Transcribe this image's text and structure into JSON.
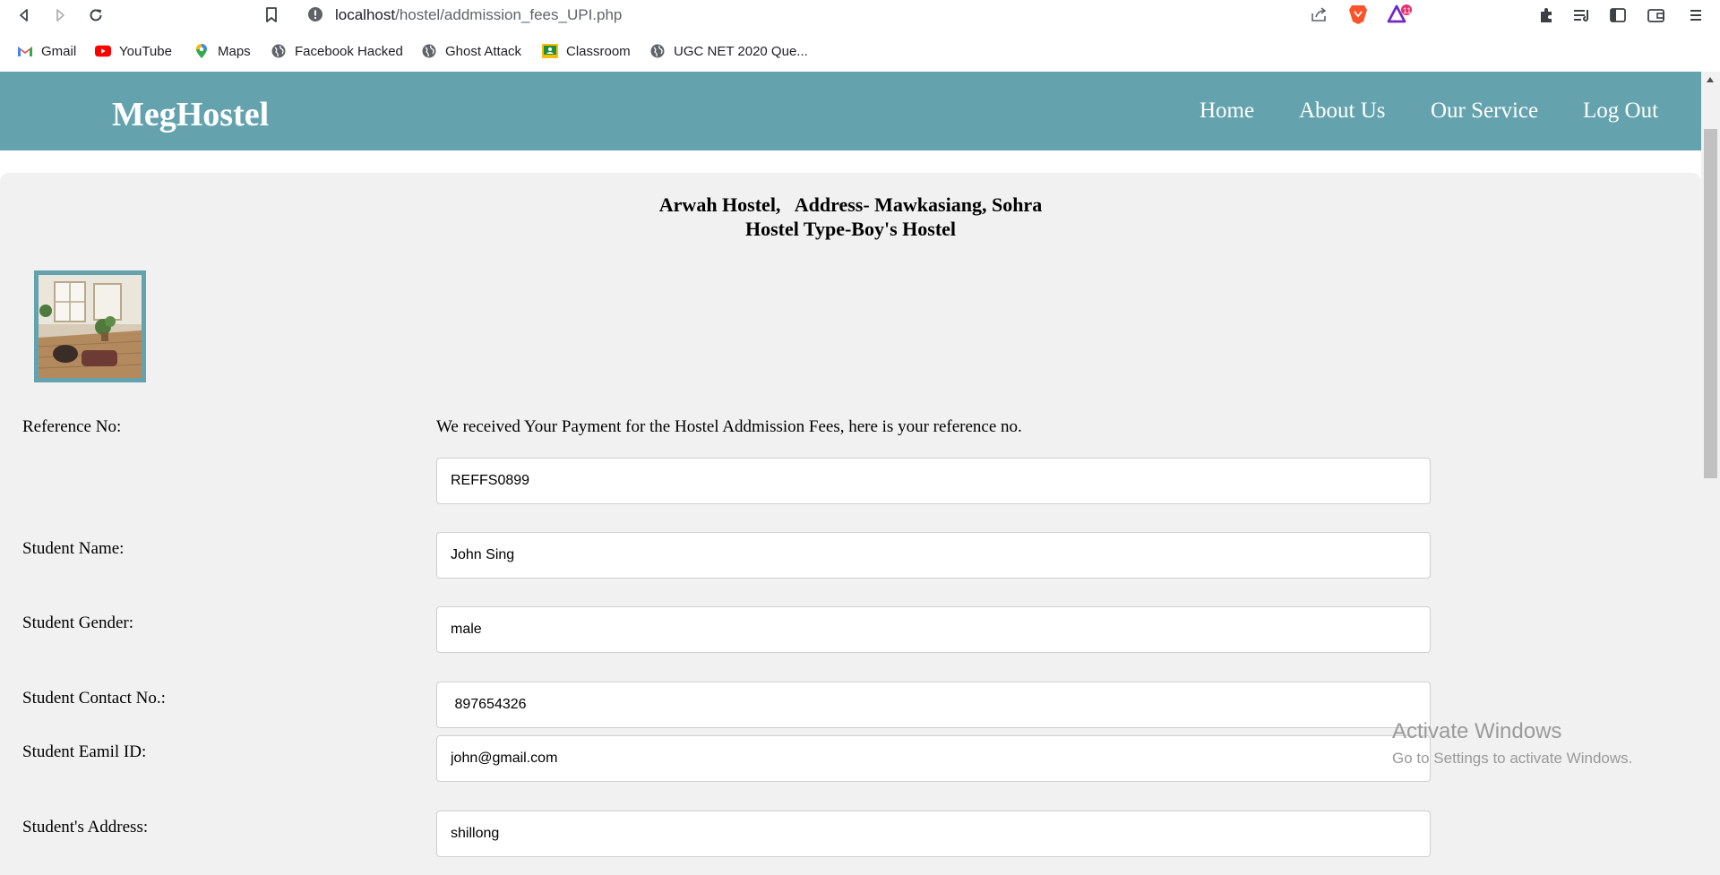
{
  "browser": {
    "url_host": "localhost",
    "url_path": "/hostel/addmission_fees_UPI.php",
    "extension_badge": "11"
  },
  "bookmarks": [
    {
      "label": "Gmail",
      "icon": "gmail-icon"
    },
    {
      "label": "YouTube",
      "icon": "youtube-icon"
    },
    {
      "label": "Maps",
      "icon": "maps-icon"
    },
    {
      "label": "Facebook Hacked",
      "icon": "globe-icon"
    },
    {
      "label": "Ghost Attack",
      "icon": "globe-icon"
    },
    {
      "label": "Classroom",
      "icon": "classroom-icon"
    },
    {
      "label": "UGC NET 2020 Que...",
      "icon": "globe-icon"
    }
  ],
  "site": {
    "logo": "MegHostel",
    "nav": [
      "Home",
      "About Us",
      "Our Service",
      "Log Out"
    ],
    "brand_color": "#64a3ae"
  },
  "hostel": {
    "line1": "Arwah Hostel,   Address- Mawkasiang, Sohra",
    "line2": "Hostel Type-Boy's Hostel"
  },
  "form": {
    "reference_notice": "We received Your Payment for the Hostel Addmission Fees, here is your reference no.",
    "fields": [
      {
        "label": "Reference No:",
        "value": "REFFS0899"
      },
      {
        "label": "Student Name:",
        "value": "John Sing"
      },
      {
        "label": "Student Gender:",
        "value": "male"
      },
      {
        "label": "Student Contact No.:",
        "value": " 897654326"
      },
      {
        "label": "Student Eamil ID:",
        "value": "john@gmail.com"
      },
      {
        "label": "Student's Address:",
        "value": "shillong"
      }
    ]
  },
  "watermark": {
    "title": "Activate Windows",
    "subtitle": "Go to Settings to activate Windows."
  }
}
